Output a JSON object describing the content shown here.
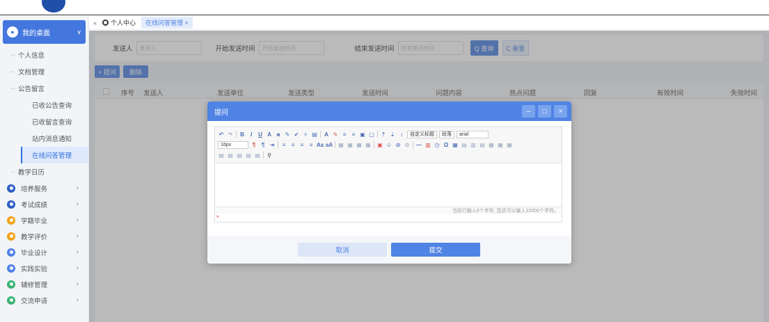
{
  "sidebar": {
    "head_label": "我的桌面",
    "personal_info": "个人信息",
    "doc_manage": "文档管理",
    "bulletin": "公告留言",
    "sub_items": [
      "已收公告查询",
      "已收留言查询",
      "站内消息通知",
      "在线问答管理"
    ],
    "teaching_calendar": "教学日历",
    "menus": [
      {
        "label": "培养服务",
        "color": "#2d5fc4"
      },
      {
        "label": "考试成绩",
        "color": "#2d5fc4"
      },
      {
        "label": "学籍毕业",
        "color": "#f0a21b"
      },
      {
        "label": "教学评价",
        "color": "#f0a21b"
      },
      {
        "label": "毕业设计",
        "color": "#4f83e4"
      },
      {
        "label": "实践实验",
        "color": "#4f83e4"
      },
      {
        "label": "辅修管理",
        "color": "#3cb371"
      },
      {
        "label": "交流申请",
        "color": "#3cb371"
      }
    ]
  },
  "tabs": {
    "collapse": "«",
    "home": "个人中心",
    "active": "在线问答管理 ×"
  },
  "filter": {
    "sender_label": "发送人",
    "sender_placeholder": "发送人",
    "start_label": "开始发送时间",
    "start_placeholder": "开始发送时间",
    "end_label": "结束发送时间",
    "end_placeholder": "结束发送时间",
    "search_btn": "Q 查询",
    "reset_btn": "C 重置"
  },
  "actions": {
    "ask": "+ 提问",
    "delete": "删除"
  },
  "table": {
    "columns": [
      "序号",
      "发送人",
      "发送单位",
      "发送类型",
      "发送时间",
      "问题内容",
      "热点问题",
      "回复",
      "有效时间",
      "失效时间"
    ]
  },
  "modal": {
    "title": "提问",
    "min": "–",
    "max": "□",
    "close": "×",
    "font_style": "自定义标题",
    "paragraph": "段落",
    "font_family": "arial",
    "font_size": "16px",
    "status_text": "当前已输入0个字符, 您还可以输入10000个字符。",
    "required_mark": "*",
    "cancel": "取消",
    "submit": "提交"
  }
}
